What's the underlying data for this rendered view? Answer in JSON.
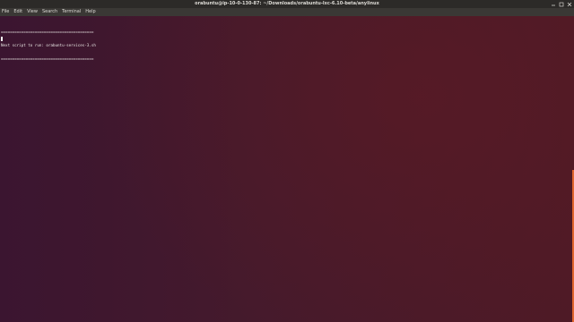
{
  "window": {
    "title": "orabuntu@ip-10-0-130-87: ~/Downloads/orabuntu-lxc-6.10-beta/anylinux"
  },
  "menubar": {
    "items": [
      "File",
      "Edit",
      "View",
      "Search",
      "Terminal",
      "Help"
    ]
  },
  "terminal": {
    "lines": [
      "=========================================",
      "Next script to run: orabuntu-services-3.sh",
      "========================================="
    ]
  },
  "colors": {
    "accent": "#e0652e",
    "terminal_background": "#451a2c"
  },
  "icons": {
    "minimize": "minimize-icon",
    "maximize": "maximize-icon",
    "close": "close-icon"
  }
}
